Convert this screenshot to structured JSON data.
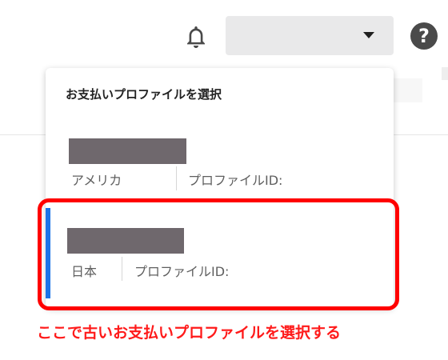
{
  "header": {
    "notifications_icon": "bell-icon",
    "account_select_value": "",
    "account_caret_icon": "caret-down-icon",
    "help_icon": "help-icon",
    "help_glyph": "?"
  },
  "dropdown": {
    "title": "お支払いプロファイルを選択",
    "profiles": [
      {
        "country": "アメリカ",
        "profile_id_label": "プロファイルID:",
        "selected": false
      },
      {
        "country": "日本",
        "profile_id_label": "プロファイルID:",
        "selected": true
      }
    ]
  },
  "annotation": {
    "text": "ここで古いお支払いプロファイルを選択する",
    "color": "#ff0000"
  },
  "colors": {
    "selected_indicator": "#1a73e8",
    "redaction": "#6f686d"
  }
}
